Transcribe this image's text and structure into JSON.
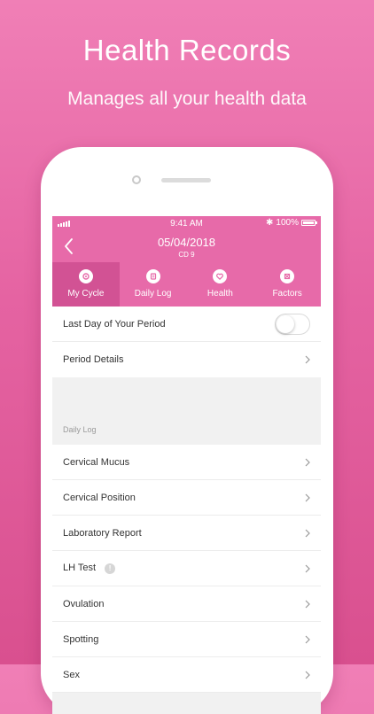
{
  "hero": {
    "title": "Health Records",
    "subtitle": "Manages all your health data"
  },
  "status_bar": {
    "time": "9:41 AM",
    "battery": "100%"
  },
  "header": {
    "date": "05/04/2018",
    "cycle_day": "CD 9"
  },
  "tabs": [
    {
      "label": "My Cycle",
      "icon": "cycle-icon",
      "active": true
    },
    {
      "label": "Daily Log",
      "icon": "daily-log-icon",
      "active": false
    },
    {
      "label": "Health",
      "icon": "health-icon",
      "active": false
    },
    {
      "label": "Factors",
      "icon": "factors-icon",
      "active": false
    }
  ],
  "cycle": {
    "last_day_label": "Last Day of Your Period",
    "last_day_toggle": false,
    "period_details_label": "Period Details"
  },
  "daily_log": {
    "section_title": "Daily Log",
    "items": [
      {
        "label": "Cervical Mucus"
      },
      {
        "label": "Cervical Position"
      },
      {
        "label": "Laboratory Report"
      },
      {
        "label": "LH Test",
        "info_badge": "!"
      },
      {
        "label": "Ovulation"
      },
      {
        "label": "Spotting"
      },
      {
        "label": "Sex"
      }
    ]
  },
  "colors": {
    "accent": "#e76aa9",
    "active_tab": "#d25294",
    "background_top": "#f07fb6",
    "background_bottom": "#d9508f"
  }
}
